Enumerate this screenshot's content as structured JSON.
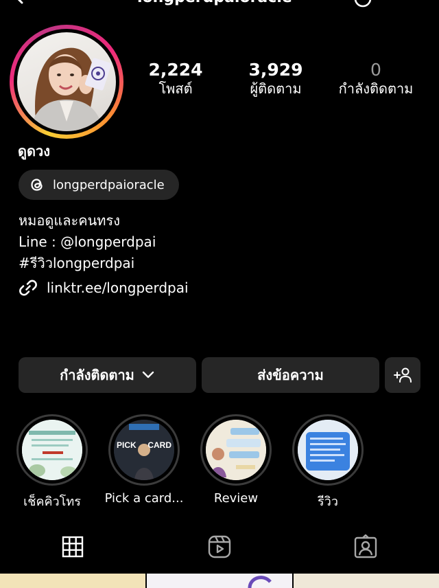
{
  "header": {
    "username": "longperdpaioracle",
    "back_icon": "chevron-left-icon",
    "threads_icon": "threads-icon"
  },
  "profile": {
    "display_name": "ดูดวง",
    "stats": [
      {
        "value": "2,224",
        "label": "โพสต์"
      },
      {
        "value": "3,929",
        "label": "ผู้ติดตาม"
      },
      {
        "value": "0",
        "label": "กำลังติดตาม"
      }
    ],
    "threads_handle": "longperdpaioracle",
    "bio_lines": [
      "หมอดูและคนทรง",
      "Line : @longperdpai",
      "#รีวิวlongperdpai"
    ],
    "link": "linktr.ee/longperdpai"
  },
  "actions": {
    "following_label": "กำลังติดตาม",
    "message_label": "ส่งข้อความ",
    "suggest_icon": "add-person-icon"
  },
  "highlights": [
    {
      "label": "เช็คคิวโทร"
    },
    {
      "label": "Pick a card..."
    },
    {
      "label": "Review"
    },
    {
      "label": "รีวิว"
    }
  ],
  "highlight_text": {
    "pick": "PICK",
    "card": "CARD"
  },
  "tabs": [
    "grid-icon",
    "reels-icon",
    "tagged-icon"
  ],
  "colors": {
    "background": "#000000",
    "button": "#262626",
    "muted": "#9a9a9a"
  }
}
